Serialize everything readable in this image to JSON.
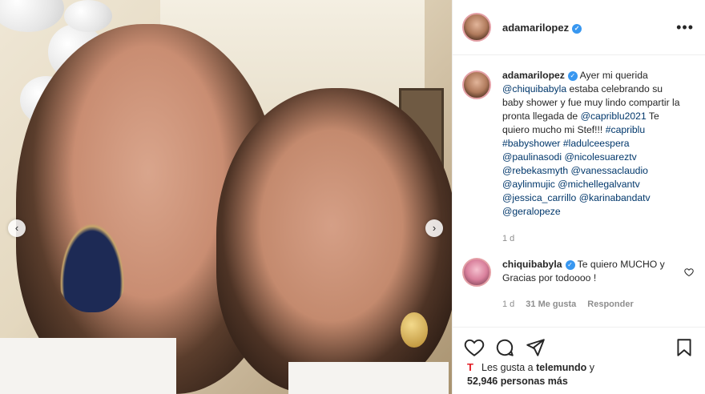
{
  "post": {
    "username": "adamarilopez",
    "more_label": "•••"
  },
  "caption": {
    "username": "adamarilopez",
    "segments": [
      {
        "t": "Ayer mi querida ",
        "link": false
      },
      {
        "t": "@chiquibabyla",
        "link": true
      },
      {
        "t": " estaba celebrando su baby shower y fue muy lindo compartir la pronta llegada de ",
        "link": false
      },
      {
        "t": "@capriblu2021",
        "link": true
      },
      {
        "t": " Te quiero mucho mi Stef!!! ",
        "link": false
      },
      {
        "t": "#capriblu",
        "link": true
      },
      {
        "t": " ",
        "link": false
      },
      {
        "t": "#babyshower",
        "link": true
      },
      {
        "t": " ",
        "link": false
      },
      {
        "t": "#ladulceespera",
        "link": true
      },
      {
        "t": " ",
        "link": false
      },
      {
        "t": "@paulinasodi",
        "link": true
      },
      {
        "t": " ",
        "link": false
      },
      {
        "t": "@nicolesuareztv",
        "link": true
      },
      {
        "t": " ",
        "link": false
      },
      {
        "t": "@rebekasmyth",
        "link": true
      },
      {
        "t": " ",
        "link": false
      },
      {
        "t": "@vanessaclaudio",
        "link": true
      },
      {
        "t": " ",
        "link": false
      },
      {
        "t": "@aylinmujic",
        "link": true
      },
      {
        "t": " ",
        "link": false
      },
      {
        "t": "@michellegalvantv",
        "link": true
      },
      {
        "t": " ",
        "link": false
      },
      {
        "t": "@jessica_carrillo",
        "link": true
      },
      {
        "t": " ",
        "link": false
      },
      {
        "t": "@karinabandatv",
        "link": true
      },
      {
        "t": " ",
        "link": false
      },
      {
        "t": "@geralopeze",
        "link": true
      }
    ],
    "time": "1 d"
  },
  "comment": {
    "username": "chiquibabyla",
    "text": "Te quiero MUCHO y Gracias por todoooo !",
    "time": "1 d",
    "likes": "31 Me gusta",
    "reply": "Responder"
  },
  "likes": {
    "prefix": "Les gusta a ",
    "user": "telemundo",
    "middle": " y",
    "count": "52,946 personas más"
  },
  "colors": {
    "link": "#00376b",
    "verified": "#3897f0",
    "brand_mark": "#e31b23"
  }
}
